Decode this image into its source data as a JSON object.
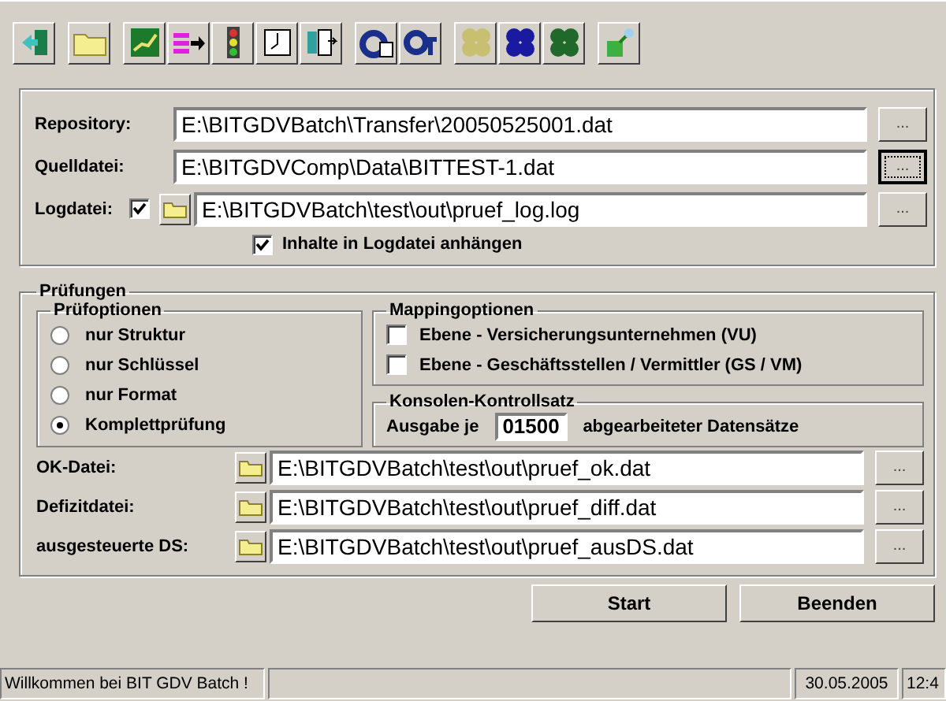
{
  "file_group": {
    "rows": [
      {
        "kind": "path",
        "label": "Repository:",
        "value": "E:\\BITGDVBatch\\Transfer\\20050525001.dat",
        "browse": "...",
        "focused": false
      },
      {
        "kind": "path",
        "label": "Quelldatei:",
        "value": "E:\\BITGDVComp\\Data\\BITTEST-1.dat",
        "browse": "...",
        "focused": true
      },
      {
        "kind": "log",
        "label": "Logdatei:",
        "checked": true,
        "value": "E:\\BITGDVBatch\\test\\out\\pruef_log.log",
        "browse": "...",
        "focused": false
      }
    ],
    "append": {
      "label": "Inhalte in Logdatei anhängen",
      "checked": true
    }
  },
  "checks": {
    "title": "Prüfungen",
    "options": {
      "title": "Prüfoptionen",
      "items": [
        {
          "label": "nur Struktur",
          "selected": false
        },
        {
          "label": "nur Schlüssel",
          "selected": false
        },
        {
          "label": "nur Format",
          "selected": false
        },
        {
          "label": "Komplettprüfung",
          "selected": true
        }
      ]
    },
    "mapping": {
      "title": "Mappingoptionen",
      "items": [
        {
          "label": "Ebene - Versicherungsunternehmen (VU)",
          "checked": false
        },
        {
          "label": "Ebene - Geschäftsstellen / Vermittler (GS / VM)",
          "checked": false
        }
      ]
    },
    "console": {
      "title": "Konsolen-Kontrollsatz",
      "prefix": "Ausgabe je",
      "value": "01500",
      "suffix": "abgearbeiteter Datensätze"
    },
    "outputs": [
      {
        "label": "OK-Datei:",
        "value": "E:\\BITGDVBatch\\test\\out\\pruef_ok.dat",
        "browse": "..."
      },
      {
        "label": "Defizitdatei:",
        "value": "E:\\BITGDVBatch\\test\\out\\pruef_diff.dat",
        "browse": "..."
      },
      {
        "label": "ausgesteuerte DS:",
        "value": "E:\\BITGDVBatch\\test\\out\\pruef_ausDS.dat",
        "browse": "..."
      }
    ]
  },
  "buttons": [
    "Start",
    "Beenden"
  ],
  "status_bar": {
    "message": "Willkommen bei BIT GDV Batch !",
    "date": "30.05.2005",
    "time": "12:4"
  }
}
